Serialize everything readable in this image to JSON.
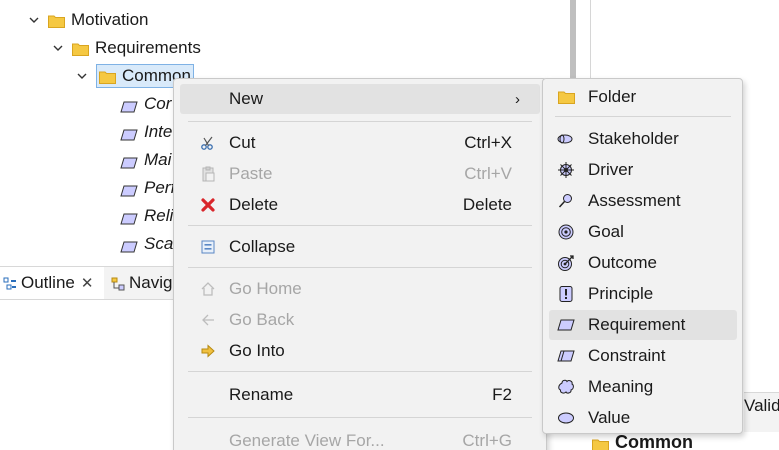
{
  "tree": {
    "items": [
      {
        "label": "Motivation"
      },
      {
        "label": "Requirements"
      },
      {
        "label": "Common"
      },
      {
        "label": "Cor"
      },
      {
        "label": "Inte"
      },
      {
        "label": "Mai"
      },
      {
        "label": "Perf"
      },
      {
        "label": "Reli"
      },
      {
        "label": "Scal"
      }
    ]
  },
  "tabs": {
    "outline": "Outline",
    "navigator": "Navig",
    "validator": "Valid"
  },
  "bottom_folder": "Common",
  "context_menu": {
    "items": [
      {
        "label": "New",
        "shortcut": "",
        "disabled": false
      },
      {
        "label": "Cut",
        "shortcut": "Ctrl+X",
        "disabled": false
      },
      {
        "label": "Paste",
        "shortcut": "Ctrl+V",
        "disabled": true
      },
      {
        "label": "Delete",
        "shortcut": "Delete",
        "disabled": false
      },
      {
        "label": "Collapse",
        "shortcut": "",
        "disabled": false
      },
      {
        "label": "Go Home",
        "shortcut": "",
        "disabled": true
      },
      {
        "label": "Go Back",
        "shortcut": "",
        "disabled": true
      },
      {
        "label": "Go Into",
        "shortcut": "",
        "disabled": false
      },
      {
        "label": "Rename",
        "shortcut": "F2",
        "disabled": false
      },
      {
        "label": "Generate View For...",
        "shortcut": "Ctrl+G",
        "disabled": true
      }
    ]
  },
  "new_submenu": {
    "items": [
      {
        "label": "Folder",
        "icon": "folder-icon"
      },
      {
        "label": "Stakeholder",
        "icon": "stakeholder-icon"
      },
      {
        "label": "Driver",
        "icon": "driver-icon"
      },
      {
        "label": "Assessment",
        "icon": "assessment-icon"
      },
      {
        "label": "Goal",
        "icon": "goal-icon"
      },
      {
        "label": "Outcome",
        "icon": "outcome-icon"
      },
      {
        "label": "Principle",
        "icon": "principle-icon"
      },
      {
        "label": "Requirement",
        "icon": "requirement-icon"
      },
      {
        "label": "Constraint",
        "icon": "constraint-icon"
      },
      {
        "label": "Meaning",
        "icon": "meaning-icon"
      },
      {
        "label": "Value",
        "icon": "value-icon"
      }
    ]
  },
  "colors": {
    "folder": "#f5c842",
    "motivation_element": "#ccccff",
    "selection": "#d9eafa",
    "delete_red": "#d9262b",
    "go_into_arrow": "#e0a51e"
  }
}
